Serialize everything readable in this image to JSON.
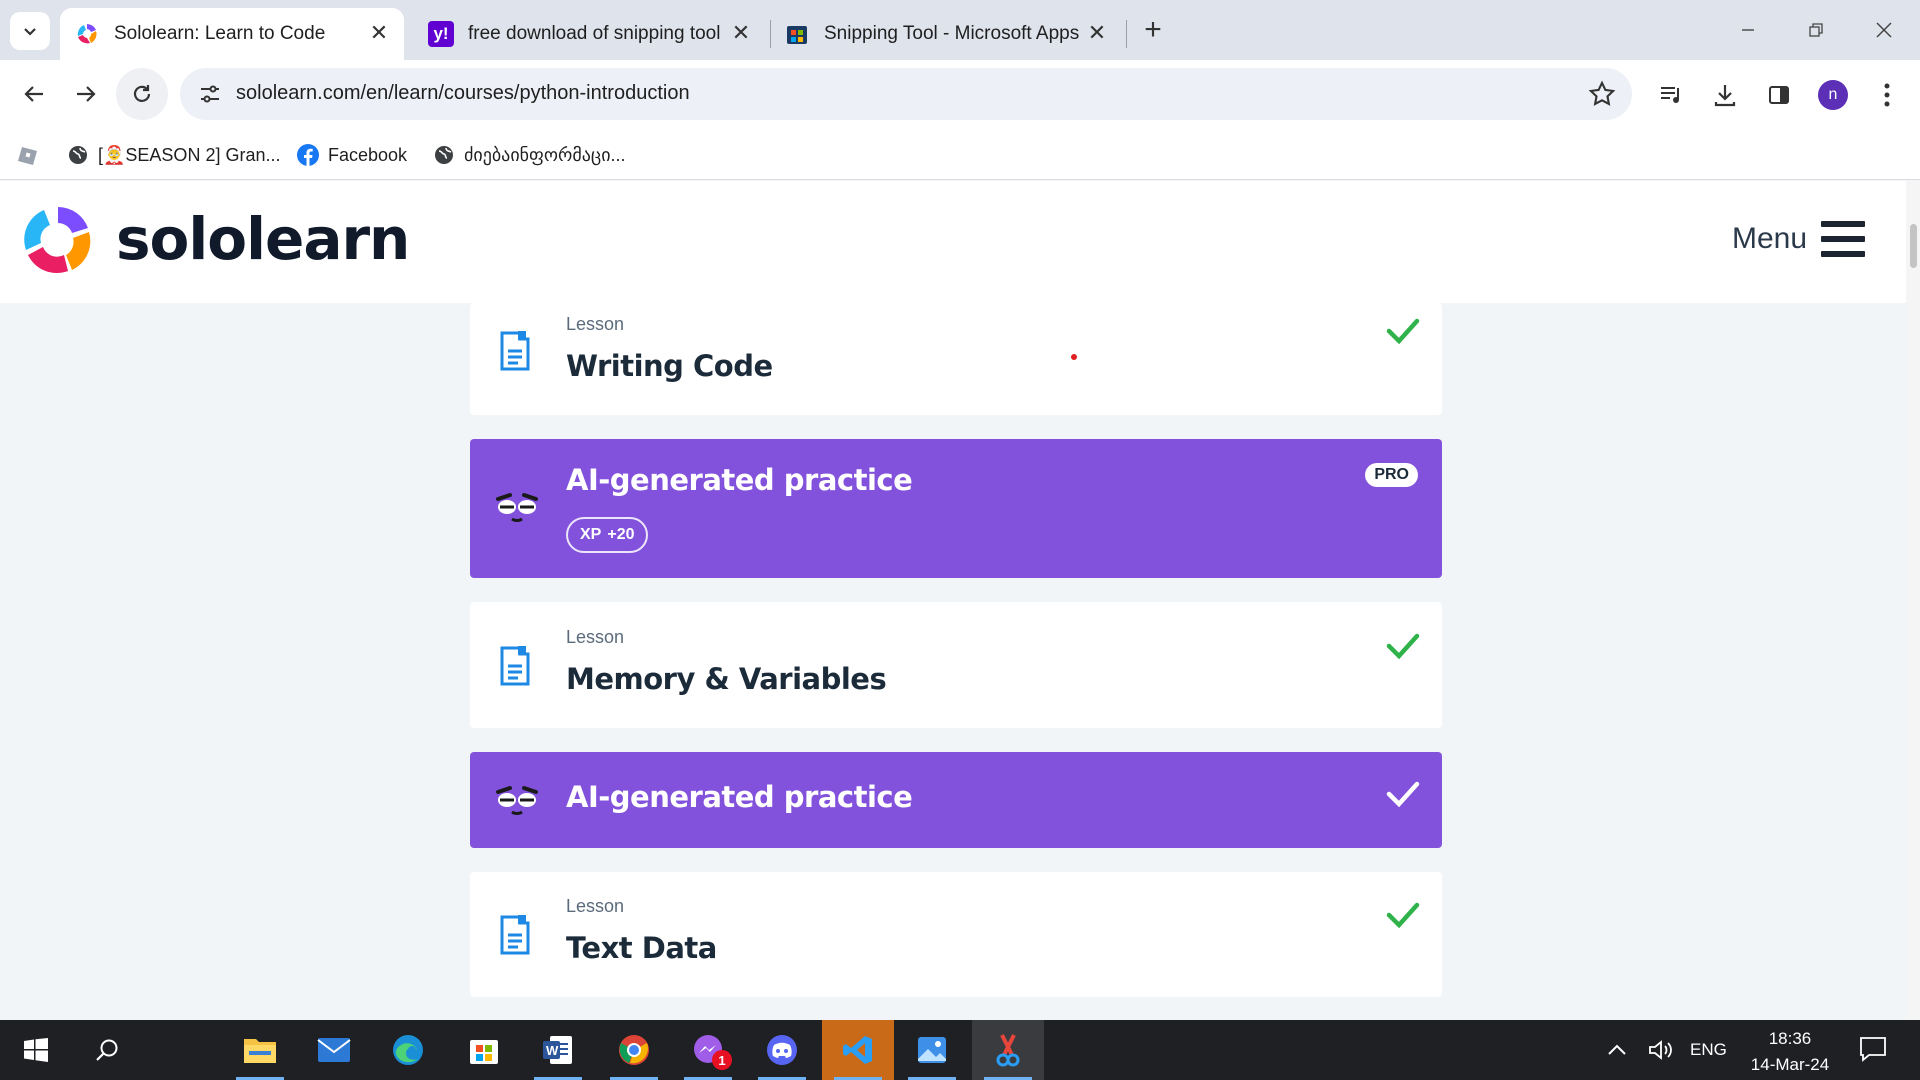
{
  "browser": {
    "tabs": [
      {
        "title": "Sololearn: Learn to Code",
        "icon": "sololearn-favicon",
        "active": true
      },
      {
        "title": "free download of snipping tool",
        "icon": "yahoo-favicon",
        "active": false
      },
      {
        "title": "Snipping Tool - Microsoft Apps",
        "icon": "microsoft-store-favicon",
        "active": false
      }
    ],
    "new_tab": "+",
    "url": "sololearn.com/en/learn/courses/python-introduction",
    "profile_initial": "n",
    "bookmarks": [
      {
        "label": "",
        "icon": "roblox-icon"
      },
      {
        "label": "[🤶SEASON 2] Gran...",
        "icon": "globe-icon"
      },
      {
        "label": "Facebook",
        "icon": "facebook-icon"
      },
      {
        "label": "ძიებაინფორმაცი...",
        "icon": "globe-icon"
      }
    ]
  },
  "site": {
    "logo_text": "sololearn",
    "menu_label": "Menu"
  },
  "course_items": [
    {
      "type": "lesson",
      "kicker": "Lesson",
      "title": "Writing Code",
      "completed": true
    },
    {
      "type": "practice",
      "title": "AI-generated practice",
      "badge": "PRO",
      "xp_label": "XP",
      "xp_value": "+20",
      "completed": false
    },
    {
      "type": "lesson",
      "kicker": "Lesson",
      "title": "Memory & Variables",
      "completed": true
    },
    {
      "type": "practice",
      "title": "AI-generated practice",
      "completed": true
    },
    {
      "type": "lesson",
      "kicker": "Lesson",
      "title": "Text Data",
      "completed": true
    }
  ],
  "colors": {
    "practice_bg": "#8352dc",
    "check_green": "#2fb24a",
    "doc_icon_blue": "#1e88e5"
  },
  "taskbar": {
    "apps": [
      "start-icon",
      "search-icon",
      "file-explorer-icon",
      "mail-icon",
      "edge-icon",
      "microsoft-store-icon",
      "word-icon",
      "chrome-icon",
      "messenger-icon",
      "discord-icon",
      "vscode-icon",
      "photos-icon",
      "snipping-tool-icon"
    ],
    "messenger_badge": "1",
    "language": "ENG",
    "time": "18:36",
    "date": "14-Mar-24"
  }
}
